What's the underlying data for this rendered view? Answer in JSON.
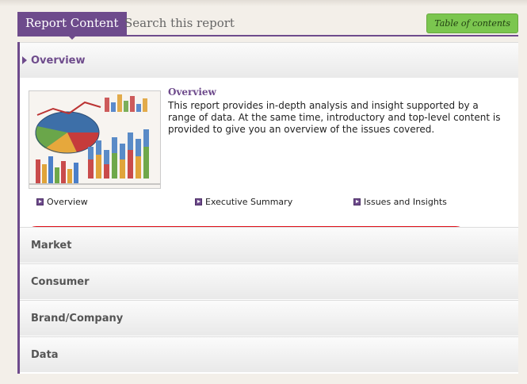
{
  "tabs": {
    "active_label": "Report Content",
    "search_label": "Search this report",
    "toc_label": "Table of contents"
  },
  "overview": {
    "header": "Overview",
    "title": "Overview",
    "description": "This report provides in-depth analysis and insight supported by a range of data. At the same time, introductory and top-level content is provided to give you an overview of the issues covered.",
    "links": [
      {
        "label": "Overview"
      },
      {
        "label": "Executive Summary"
      },
      {
        "label": "Issues and Insights"
      }
    ]
  },
  "sections": [
    {
      "label": "Market"
    },
    {
      "label": "Consumer"
    },
    {
      "label": "Brand/Company"
    },
    {
      "label": "Data"
    }
  ],
  "colors": {
    "accent": "#6e4b8c",
    "toc_button": "#7bc64f",
    "highlight": "#e0101a"
  }
}
